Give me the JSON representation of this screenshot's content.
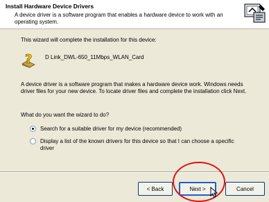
{
  "header": {
    "title": "Install Hardware Device Drivers",
    "subtitle": "A device driver is a software program that enables a hardware device to work with an operating system."
  },
  "content": {
    "intro": "This wizard will complete the installation for this device:",
    "device_name": "D Link_DWL-650_11Mbps_WLAN_Card",
    "description": "A device driver is a software program that makes a hardware device work. Windows needs driver files for your new device. To locate driver files and complete the installation click Next.",
    "question": "What do you want the wizard to do?",
    "options": [
      {
        "label": "Search for a suitable driver for my device (recommended)",
        "checked": true
      },
      {
        "label": "Display a list of the known drivers for this device so that I can choose a specific driver",
        "checked": false
      }
    ]
  },
  "buttons": {
    "back": "< Back",
    "next": "Next >",
    "cancel": "Cancel"
  },
  "colors": {
    "highlight": "#e01010",
    "dialog_bg": "#ece9d8"
  }
}
